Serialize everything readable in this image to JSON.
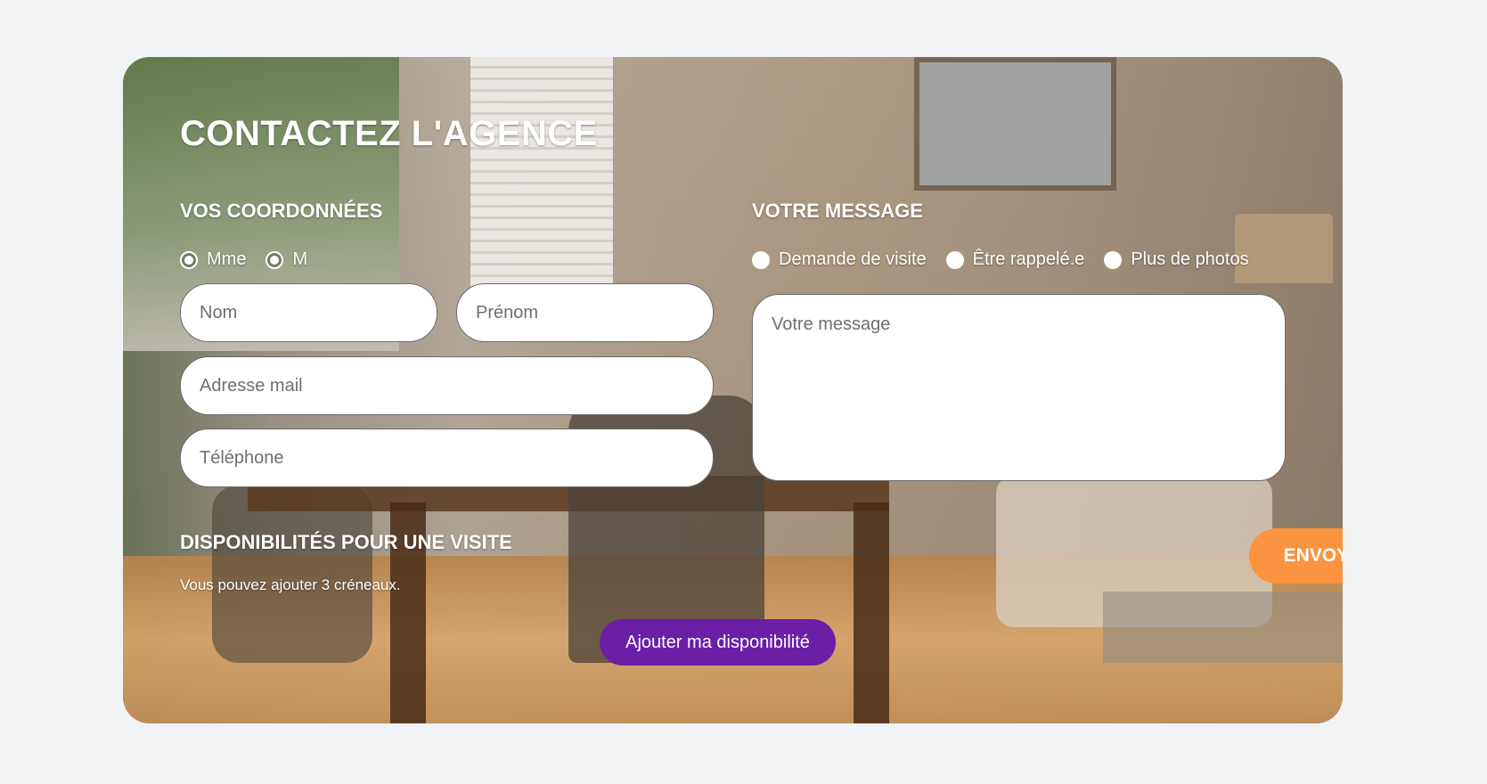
{
  "form": {
    "title": "CONTACTEZ L'AGENCE",
    "coordonnees": {
      "title": "VOS COORDONNÉES",
      "civilite_options": [
        "Mme",
        "M"
      ],
      "nom_placeholder": "Nom",
      "prenom_placeholder": "Prénom",
      "email_placeholder": "Adresse mail",
      "telephone_placeholder": "Téléphone"
    },
    "message": {
      "title": "VOTRE MESSAGE",
      "type_options": [
        "Demande de visite",
        "Être rappelé.e",
        "Plus de photos"
      ],
      "message_placeholder": "Votre message"
    },
    "disponibilites": {
      "title": "DISPONIBILITÉS POUR UNE VISITE",
      "hint": "Vous pouvez ajouter 3 créneaux.",
      "add_label": "Ajouter ma disponibilité"
    },
    "submit_label": "ENVOYER"
  },
  "colors": {
    "page_background": "#f2f3f5",
    "add_button": "#6b1fa6",
    "submit_button": "#fb9340"
  }
}
